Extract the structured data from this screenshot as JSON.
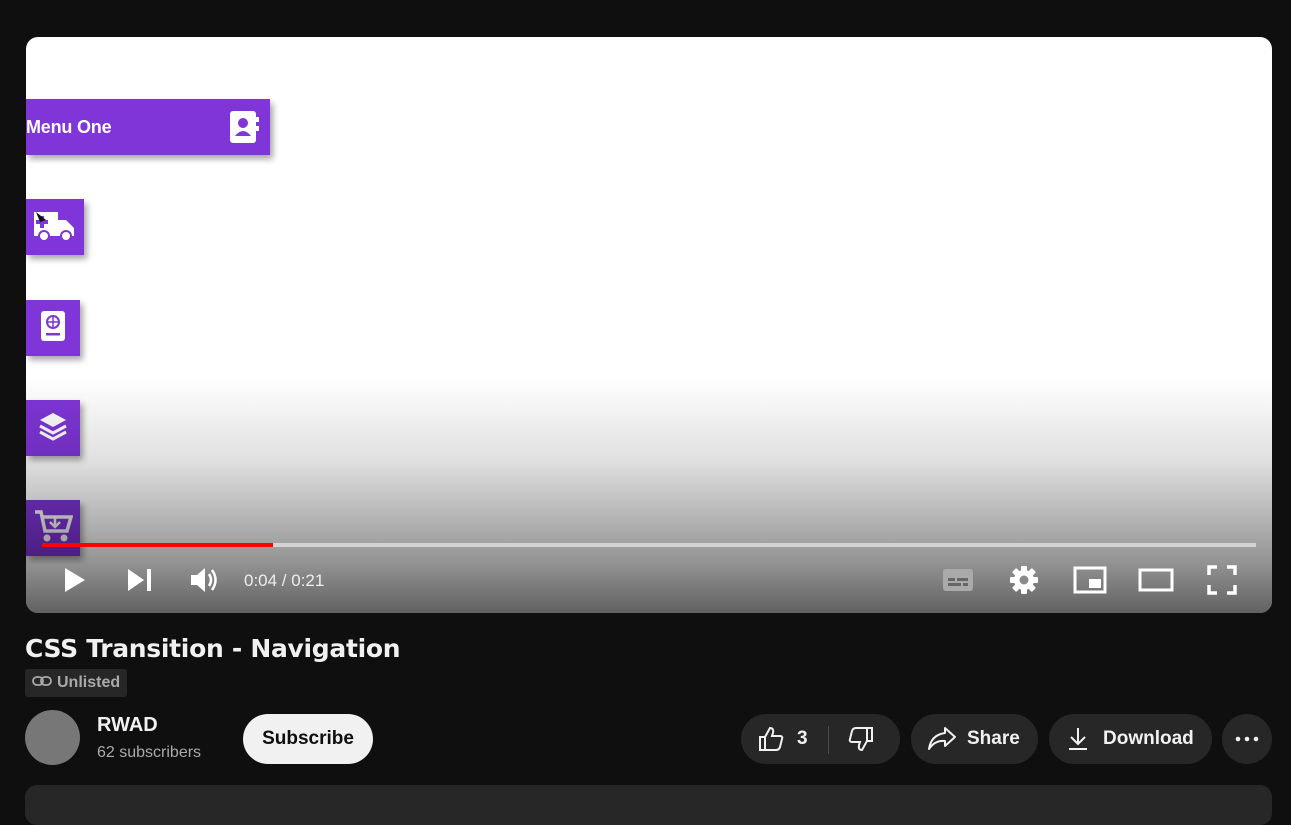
{
  "video": {
    "menu_label": "Menu One",
    "current_time": "0:04",
    "duration": "0:21",
    "time_display": "0:04 / 0:21",
    "progress_fraction": 0.19,
    "accent_color": "#ff0000",
    "menu_color": "#7f35d8"
  },
  "title": "CSS Transition - Navigation",
  "visibility": "Unlisted",
  "channel": {
    "name": "RWAD",
    "subscribers": "62 subscribers",
    "subscribe_label": "Subscribe"
  },
  "actions": {
    "like_count": "3",
    "share_label": "Share",
    "download_label": "Download"
  },
  "icons": [
    "contact-book-icon",
    "ambulance-icon",
    "passport-icon",
    "layers-icon",
    "cart-download-icon",
    "play-icon",
    "next-icon",
    "volume-icon",
    "subtitles-icon",
    "settings-icon",
    "miniplayer-icon",
    "theater-icon",
    "fullscreen-icon",
    "link-icon",
    "thumbs-up-icon",
    "thumbs-down-icon",
    "share-icon",
    "download-icon",
    "more-icon"
  ]
}
